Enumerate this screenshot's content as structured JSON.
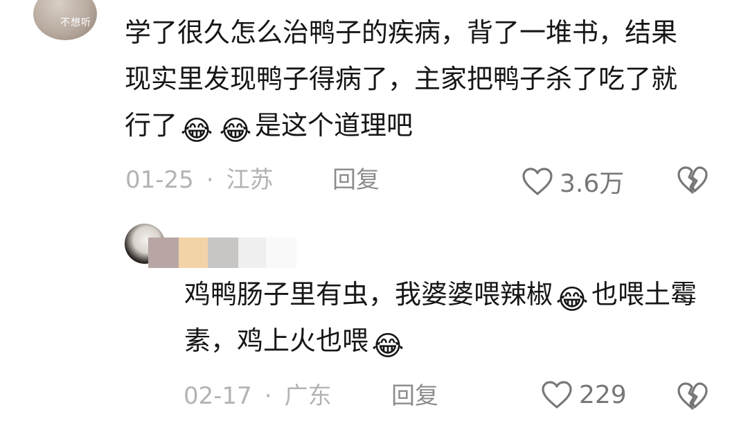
{
  "comments": [
    {
      "avatar_text": "不想听",
      "segments": [
        "学了很久怎么治鸭子的疾病，背了一堆书，结果现实里发现鸭子得病了，主家把鸭子杀了吃了就行了",
        "是这个道理吧"
      ],
      "emojis": [
        "laughing-tears-emoji",
        "laughing-tears-emoji"
      ],
      "date": "01-25",
      "separator": "·",
      "location": "江苏",
      "reply_label": "回复",
      "likes": "3.6万"
    },
    {
      "segments": [
        "鸡鸭肠子里有虫，我婆婆喂辣椒",
        "也喂土霉素，鸡上火也喂"
      ],
      "emojis": [
        "laughing-tears-emoji",
        "laughing-tears-emoji"
      ],
      "date": "02-17",
      "separator": "·",
      "location": "广东",
      "reply_label": "回复",
      "likes": "229"
    }
  ],
  "colors": {
    "text": "#161616",
    "meta": "#b3b3b3",
    "reply": "#8c8c8c",
    "icon": "#777777",
    "emoji_face": "#f7c531"
  }
}
